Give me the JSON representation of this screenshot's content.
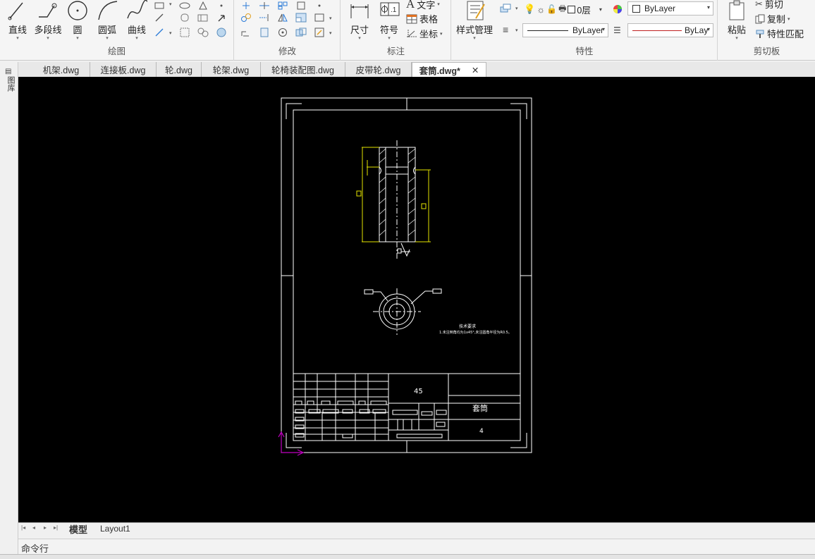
{
  "ribbon": {
    "draw": {
      "title": "绘图",
      "line": "直线",
      "polyline": "多段线",
      "circle": "圆",
      "arc": "圆弧",
      "curve": "曲线"
    },
    "modify": {
      "title": "修改"
    },
    "annotation": {
      "title": "标注",
      "dimension": "尺寸",
      "symbol": "符号",
      "text": "文字",
      "table": "表格",
      "coordinate": "坐标"
    },
    "properties": {
      "title": "特性",
      "style_manager": "样式管理",
      "layer_value": "0层",
      "color_value": "ByLayer",
      "linetype_value": "ByLayer",
      "lineweight_value": "ByLay"
    },
    "clipboard": {
      "title": "剪切板",
      "paste": "粘贴",
      "cut": "剪切",
      "copy": "复制",
      "match_props": "特性匹配"
    }
  },
  "file_tabs": [
    {
      "label": "机架.dwg",
      "active": false
    },
    {
      "label": "连接板.dwg",
      "active": false
    },
    {
      "label": "轮.dwg",
      "active": false
    },
    {
      "label": "轮架.dwg",
      "active": false
    },
    {
      "label": "轮椅装配图.dwg",
      "active": false
    },
    {
      "label": "皮带轮.dwg",
      "active": false
    },
    {
      "label": "套筒.dwg*",
      "active": true
    }
  ],
  "left_strip": {
    "label": "图库"
  },
  "drawing": {
    "material": "45",
    "part_name": "套筒",
    "quantity": "4",
    "tech_req_title": "技术要求",
    "tech_req_text": "1.未注倒角均为1x45°,未注圆角半径为R0.5。"
  },
  "layout_tabs": [
    {
      "label": "模型",
      "active": true
    },
    {
      "label": "Layout1",
      "active": false
    }
  ],
  "command_line": {
    "label": "命令行"
  },
  "colors": {
    "canvas_bg": "#000000",
    "line_white": "#ffffff",
    "dim_yellow": "#e4e400",
    "ucs_magenta": "#c000c0",
    "ribbon_bg": "#f5f5f5"
  }
}
